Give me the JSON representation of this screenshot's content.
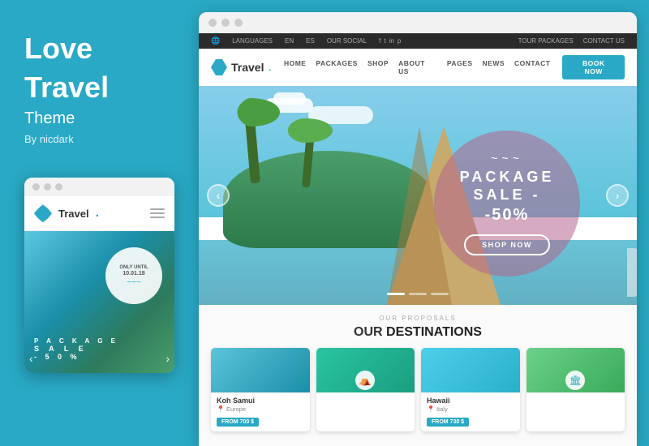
{
  "left": {
    "title1": "Love",
    "title2": "Travel",
    "subtitle": "Theme",
    "author": "By nicdark",
    "mobile": {
      "logo_text": "Travel",
      "logo_dot": ".",
      "only_until": "ONLY UNTIL",
      "date": "10.01.18",
      "tilde": "~~~",
      "sale_lines": [
        "P A C K A G E",
        "S A L E",
        "- 5 0 %"
      ]
    }
  },
  "desktop": {
    "topbar": {
      "languages": "LANGUAGES",
      "lang_en": "EN",
      "lang_es": "ES",
      "our_social": "OUR SOCIAL",
      "tour_packages": "TOUR PACKAGES",
      "contact_us": "CONTACT US"
    },
    "nav": {
      "logo_text": "Travel",
      "logo_dot": ".",
      "links": [
        "HOME",
        "PACKAGES",
        "SHOP",
        "ABOUT US",
        "PAGES",
        "NEWS",
        "CONTACT"
      ],
      "book_now": "BOOK NOW"
    },
    "hero": {
      "tilde": "~~~",
      "package_label": "PACKAGE",
      "sale_label": "SALE -",
      "fifty_label": "-50%",
      "shop_now": "SHOP NOW",
      "arrow_left": "‹",
      "arrow_right": "›"
    },
    "proposals": {
      "eyebrow": "OUR PROPOSALS",
      "title_plain": "OUR ",
      "title_bold": "DESTINATIONS",
      "destinations": [
        {
          "name": "Koh Samui",
          "region": "Europe",
          "price": "FROM 700 $",
          "img_class": "dest-img-blue"
        },
        {
          "name": "",
          "region": "",
          "price": "",
          "img_class": "dest-img-teal"
        },
        {
          "name": "Hawaii",
          "region": "Italy",
          "price": "FROM 730 $",
          "img_class": "dest-img-aqua"
        },
        {
          "name": "",
          "region": "",
          "price": "",
          "img_class": "dest-img-green"
        }
      ]
    }
  }
}
